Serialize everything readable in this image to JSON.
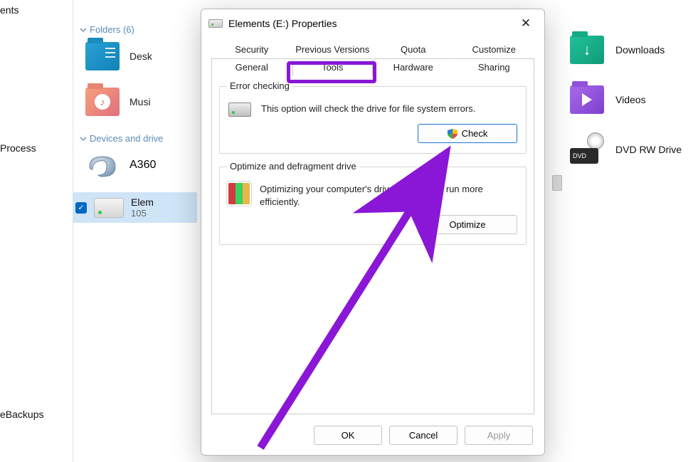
{
  "nav": {
    "documents_partial": "ents",
    "process": "Process",
    "backups": "eBackups"
  },
  "explorer": {
    "folders_header": "Folders (6)",
    "devices_header": "Devices and drive",
    "items": {
      "desktop": "Desk",
      "music": "Musi",
      "a360": "A360",
      "elements_name": "Elem",
      "elements_sub": "105",
      "downloads": "Downloads",
      "videos": "Videos",
      "dvd": "DVD RW Drive",
      "dvd_badge": "DVD"
    }
  },
  "dialog": {
    "title": "Elements (E:) Properties",
    "tabs_row1": [
      "Security",
      "Previous Versions",
      "Quota",
      "Customize"
    ],
    "tabs_row2": [
      "General",
      "Tools",
      "Hardware",
      "Sharing"
    ],
    "active_tab": "Tools",
    "error_group": {
      "title": "Error checking",
      "desc": "This option will check the drive for file system errors.",
      "button": "Check"
    },
    "opt_group": {
      "title": "Optimize and defragment drive",
      "desc": "Optimizing your computer's drives can help it run more efficiently.",
      "button": "Optimize"
    },
    "footer": {
      "ok": "OK",
      "cancel": "Cancel",
      "apply": "Apply"
    }
  }
}
